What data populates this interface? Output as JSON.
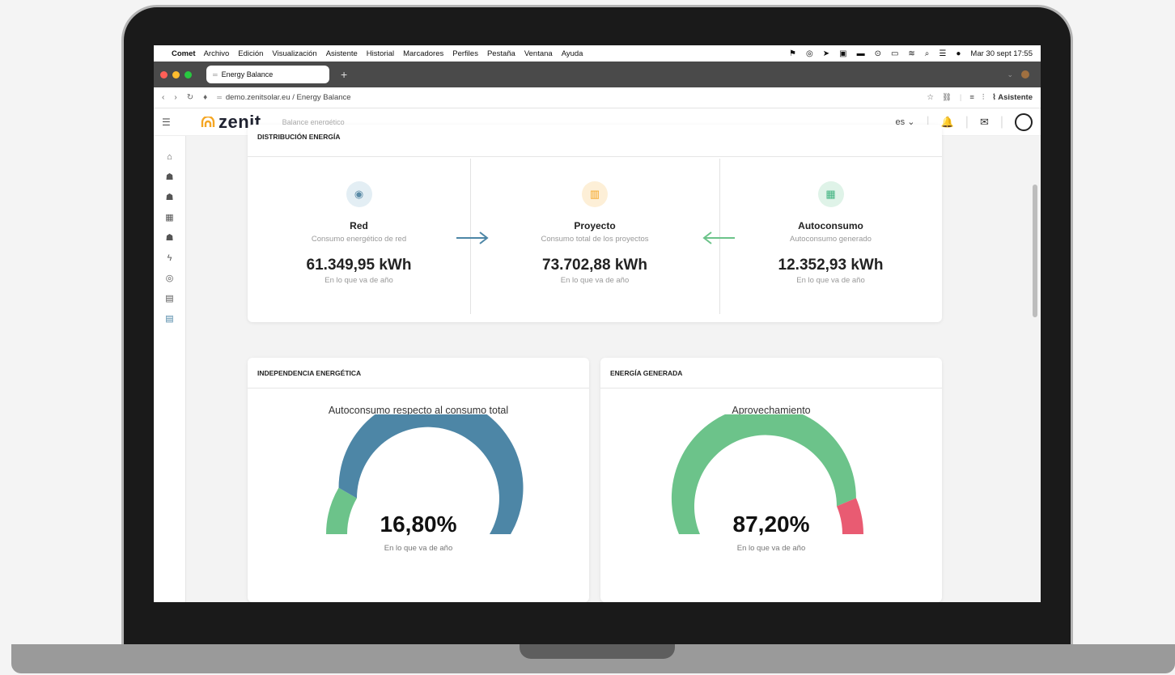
{
  "menubar": {
    "app_name": "Comet",
    "items": [
      "Archivo",
      "Edición",
      "Visualización",
      "Asistente",
      "Historial",
      "Marcadores",
      "Perfiles",
      "Pestaña",
      "Ventana",
      "Ayuda"
    ],
    "datetime": "Mar 30 sept 17:55"
  },
  "browser": {
    "tab_title": "Energy Balance",
    "url": "demo.zenitsolar.eu / Energy Balance",
    "assistant_label": "Asistente"
  },
  "app": {
    "logo_text": "zenit",
    "subtitle": "Balance energético",
    "language": "es",
    "accent_color": "#f5a623"
  },
  "distribution": {
    "title": "DISTRIBUCIÓN ENERGÍA",
    "items": [
      {
        "name": "Red",
        "desc": "Consumo energético de red",
        "value": "61.349,95 kWh",
        "period": "En lo que va de año",
        "icon": "antenna-icon",
        "color": "#5a8aa6"
      },
      {
        "name": "Proyecto",
        "desc": "Consumo total de los proyectos",
        "value": "73.702,88 kWh",
        "period": "En lo que va de año",
        "icon": "building-icon",
        "color": "#f5a623"
      },
      {
        "name": "Autoconsumo",
        "desc": "Autoconsumo generado",
        "value": "12.352,93 kWh",
        "period": "En lo que va de año",
        "icon": "solar-panel-icon",
        "color": "#3fb27f"
      }
    ]
  },
  "independence": {
    "title": "INDEPENDENCIA ENERGÉTICA",
    "subtitle": "Autoconsumo respecto al consumo total",
    "value": "16,80%",
    "fraction": 0.168,
    "period": "En lo que va de año",
    "fill_color": "#6cc38a",
    "rest_color": "#4d86a6"
  },
  "generated": {
    "title": "ENERGÍA GENERADA",
    "subtitle": "Aprovechamiento",
    "value": "87,20%",
    "fraction": 0.872,
    "period": "En lo que va de año",
    "fill_color": "#6cc38a",
    "rest_color": "#e95b72"
  }
}
